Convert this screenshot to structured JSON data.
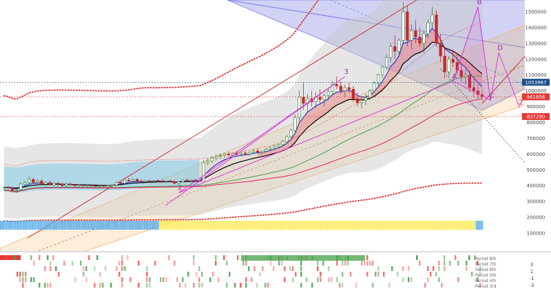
{
  "colors": {
    "up": "#2e7d32",
    "down": "#c62828",
    "candle_body_up": "#ffffff",
    "channel_blue": "#7b7fe0",
    "channel_orange": "#f5b25c",
    "ema_fill": "#f08080",
    "cloud_blue": "#6ec6e6",
    "cloud_gray": "#c8c8c8",
    "wave_purple": "#d63bd6",
    "trend_red": "#d32f2f",
    "price_red": "#e53935",
    "indicator_yellow": "#ffe94d",
    "indicator_blue": "#4fa8e8"
  },
  "price_axis": {
    "ticks": [
      "1500000",
      "1400000",
      "1300000",
      "1200000",
      "1100000",
      "1000000",
      "900000",
      "800000",
      "700000",
      "600000",
      "500000",
      "400000",
      "300000",
      "200000",
      "100000"
    ],
    "tags": [
      {
        "label": "1053967",
        "value": 1053967,
        "style": "blue"
      },
      {
        "label": "961856",
        "value": 961856,
        "style": "red"
      },
      {
        "label": "837290",
        "value": 837290,
        "style": "red"
      }
    ]
  },
  "indicator_axis": {
    "ticks": [
      "3",
      "1",
      "-1",
      "-3"
    ],
    "period_labels": [
      "Period 8th",
      "Period 7th",
      "Period 6th",
      "Period 5th",
      "Period 4th",
      "Period 3rd"
    ]
  },
  "wave_labels": [
    {
      "label": "3",
      "value": 1090000,
      "index": 82
    },
    {
      "label": "2",
      "value": 355000,
      "index": 42
    },
    {
      "label": "A",
      "value": 1060000,
      "index": 108
    },
    {
      "label": "B",
      "value": 1530000,
      "index": 114
    },
    {
      "label": "C",
      "value": 940000,
      "index": 117
    },
    {
      "label": "D",
      "value": 1240000,
      "index": 119
    },
    {
      "label": "2",
      "value": 895000,
      "index": 124
    }
  ],
  "chart_data": {
    "type": "candlestick",
    "title": "",
    "xlabel": "",
    "ylabel": "",
    "ylim": [
      90000,
      1560000
    ],
    "grid": false,
    "candles": [
      [
        385000,
        395000,
        370000,
        390000
      ],
      [
        390000,
        400000,
        380000,
        385000
      ],
      [
        385000,
        392000,
        360000,
        370000
      ],
      [
        370000,
        380000,
        355000,
        375000
      ],
      [
        375000,
        420000,
        370000,
        410000
      ],
      [
        410000,
        430000,
        400000,
        420000
      ],
      [
        420000,
        460000,
        410000,
        440000
      ],
      [
        440000,
        450000,
        410000,
        420000
      ],
      [
        420000,
        440000,
        400000,
        430000
      ],
      [
        430000,
        440000,
        405000,
        410000
      ],
      [
        410000,
        425000,
        395000,
        420000
      ],
      [
        420000,
        430000,
        400000,
        405000
      ],
      [
        405000,
        420000,
        395000,
        415000
      ],
      [
        415000,
        425000,
        400000,
        410000
      ],
      [
        410000,
        420000,
        395000,
        400000
      ],
      [
        400000,
        415000,
        390000,
        410000
      ],
      [
        410000,
        420000,
        400000,
        405000
      ],
      [
        405000,
        412000,
        392000,
        400000
      ],
      [
        400000,
        410000,
        392000,
        405000
      ],
      [
        405000,
        412000,
        396000,
        398000
      ],
      [
        398000,
        408000,
        390000,
        402000
      ],
      [
        402000,
        410000,
        395000,
        400000
      ],
      [
        400000,
        410000,
        390000,
        395000
      ],
      [
        395000,
        405000,
        385000,
        400000
      ],
      [
        400000,
        408000,
        392000,
        398000
      ],
      [
        398000,
        405000,
        390000,
        402000
      ],
      [
        402000,
        410000,
        396000,
        405000
      ],
      [
        405000,
        425000,
        400000,
        420000
      ],
      [
        420000,
        430000,
        410000,
        415000
      ],
      [
        415000,
        440000,
        410000,
        435000
      ],
      [
        435000,
        450000,
        425000,
        430000
      ],
      [
        430000,
        445000,
        420000,
        440000
      ],
      [
        440000,
        448000,
        425000,
        430000
      ],
      [
        430000,
        440000,
        420000,
        425000
      ],
      [
        425000,
        435000,
        415000,
        430000
      ],
      [
        430000,
        438000,
        420000,
        428000
      ],
      [
        428000,
        436000,
        420000,
        432000
      ],
      [
        432000,
        440000,
        424000,
        430000
      ],
      [
        430000,
        438000,
        422000,
        426000
      ],
      [
        426000,
        434000,
        418000,
        430000
      ],
      [
        430000,
        440000,
        420000,
        425000
      ],
      [
        425000,
        435000,
        410000,
        415000
      ],
      [
        415000,
        430000,
        405000,
        425000
      ],
      [
        425000,
        440000,
        420000,
        435000
      ],
      [
        435000,
        445000,
        425000,
        430000
      ],
      [
        430000,
        440000,
        420000,
        436000
      ],
      [
        436000,
        442000,
        426000,
        430000
      ],
      [
        430000,
        436000,
        424000,
        428000
      ],
      [
        428000,
        560000,
        425000,
        545000
      ],
      [
        545000,
        570000,
        530000,
        555000
      ],
      [
        555000,
        585000,
        545000,
        575000
      ],
      [
        575000,
        600000,
        560000,
        585000
      ],
      [
        585000,
        605000,
        570000,
        590000
      ],
      [
        590000,
        610000,
        575000,
        600000
      ],
      [
        600000,
        615000,
        585000,
        595000
      ],
      [
        595000,
        610000,
        580000,
        605000
      ],
      [
        605000,
        620000,
        590000,
        598000
      ],
      [
        598000,
        612000,
        585000,
        606000
      ],
      [
        606000,
        618000,
        592000,
        600000
      ],
      [
        600000,
        615000,
        588000,
        612000
      ],
      [
        612000,
        630000,
        600000,
        620000
      ],
      [
        620000,
        635000,
        605000,
        610000
      ],
      [
        610000,
        625000,
        598000,
        618000
      ],
      [
        618000,
        640000,
        610000,
        630000
      ],
      [
        630000,
        650000,
        620000,
        640000
      ],
      [
        640000,
        660000,
        630000,
        650000
      ],
      [
        650000,
        670000,
        640000,
        660000
      ],
      [
        660000,
        690000,
        650000,
        680000
      ],
      [
        680000,
        720000,
        670000,
        710000
      ],
      [
        710000,
        760000,
        700000,
        750000
      ],
      [
        750000,
        850000,
        740000,
        830000
      ],
      [
        830000,
        1000000,
        810000,
        960000
      ],
      [
        960000,
        1050000,
        880000,
        920000
      ],
      [
        920000,
        980000,
        870000,
        950000
      ],
      [
        950000,
        1000000,
        900000,
        930000
      ],
      [
        930000,
        990000,
        890000,
        960000
      ],
      [
        960000,
        1010000,
        920000,
        945000
      ],
      [
        945000,
        985000,
        900000,
        970000
      ],
      [
        970000,
        1020000,
        940000,
        995000
      ],
      [
        995000,
        1060000,
        970000,
        1040000
      ],
      [
        1040000,
        1090000,
        1010000,
        1030000
      ],
      [
        1030000,
        1060000,
        980000,
        1000000
      ],
      [
        1000000,
        1040000,
        960000,
        1020000
      ],
      [
        1020000,
        1050000,
        990000,
        1010000
      ],
      [
        1010000,
        1030000,
        930000,
        950000
      ],
      [
        950000,
        990000,
        900000,
        925000
      ],
      [
        925000,
        965000,
        890000,
        940000
      ],
      [
        940000,
        980000,
        910000,
        955000
      ],
      [
        955000,
        1010000,
        940000,
        1000000
      ],
      [
        1000000,
        1060000,
        990000,
        1050000
      ],
      [
        1050000,
        1110000,
        1030000,
        1100000
      ],
      [
        1100000,
        1160000,
        1080000,
        1150000
      ],
      [
        1150000,
        1230000,
        1130000,
        1210000
      ],
      [
        1210000,
        1300000,
        1180000,
        1280000
      ],
      [
        1280000,
        1350000,
        1200000,
        1250000
      ],
      [
        1250000,
        1330000,
        1220000,
        1320000
      ],
      [
        1320000,
        1560000,
        1300000,
        1500000
      ],
      [
        1500000,
        1540000,
        1280000,
        1320000
      ],
      [
        1320000,
        1420000,
        1260000,
        1380000
      ],
      [
        1380000,
        1450000,
        1300000,
        1340000
      ],
      [
        1340000,
        1400000,
        1280000,
        1300000
      ],
      [
        1300000,
        1380000,
        1240000,
        1360000
      ],
      [
        1360000,
        1450000,
        1330000,
        1430000
      ],
      [
        1430000,
        1530000,
        1400000,
        1480000
      ],
      [
        1480000,
        1510000,
        1280000,
        1300000
      ],
      [
        1300000,
        1360000,
        1180000,
        1220000
      ],
      [
        1220000,
        1280000,
        1080000,
        1120000
      ],
      [
        1120000,
        1220000,
        1090000,
        1200000
      ],
      [
        1200000,
        1260000,
        1150000,
        1180000
      ],
      [
        1180000,
        1240000,
        1100000,
        1130000
      ],
      [
        1130000,
        1180000,
        1060000,
        1090000
      ],
      [
        1090000,
        1140000,
        1040000,
        1100000
      ],
      [
        1100000,
        1130000,
        990000,
        1020000
      ],
      [
        1020000,
        1080000,
        960000,
        1000000
      ],
      [
        1000000,
        1040000,
        950000,
        975000
      ],
      [
        975000,
        1010000,
        940000,
        961856
      ]
    ]
  }
}
